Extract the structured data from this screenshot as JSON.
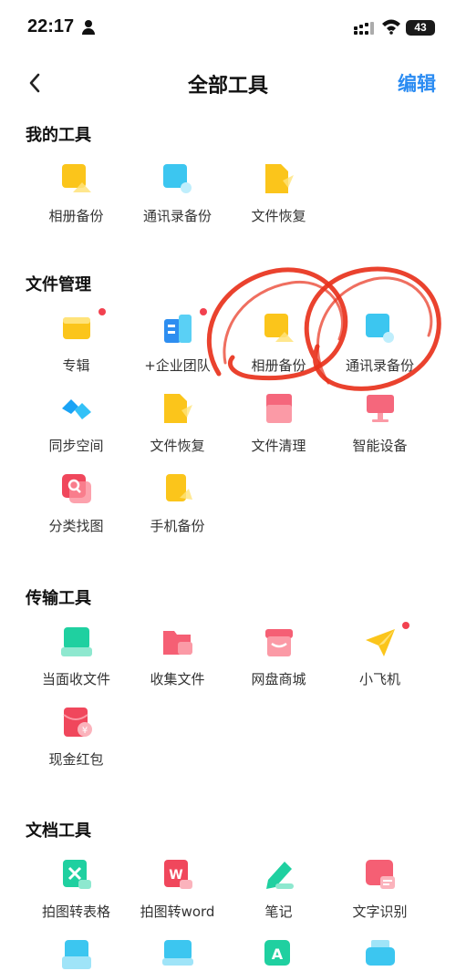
{
  "status_bar": {
    "time": "22:17",
    "battery": "43"
  },
  "header": {
    "title": "全部工具",
    "edit_label": "编辑"
  },
  "sections": [
    {
      "title": "我的工具",
      "tools": [
        {
          "label": "相册备份",
          "icon": "photo-backup-icon"
        },
        {
          "label": "通讯录备份",
          "icon": "contacts-backup-icon"
        },
        {
          "label": "文件恢复",
          "icon": "file-recovery-icon"
        },
        {
          "label": "",
          "icon": "empty-slot"
        }
      ]
    },
    {
      "title": "文件管理",
      "tools": [
        {
          "label": "专辑",
          "icon": "album-icon",
          "badge": true
        },
        {
          "label": "+企业团队",
          "icon": "enterprise-team-icon",
          "badge": true
        },
        {
          "label": "相册备份",
          "icon": "photo-backup-icon"
        },
        {
          "label": "通讯录备份",
          "icon": "contacts-backup-icon"
        },
        {
          "label": "同步空间",
          "icon": "sync-space-icon"
        },
        {
          "label": "文件恢复",
          "icon": "file-recovery-icon"
        },
        {
          "label": "文件清理",
          "icon": "file-cleanup-icon"
        },
        {
          "label": "智能设备",
          "icon": "smart-device-icon"
        },
        {
          "label": "分类找图",
          "icon": "category-search-icon"
        },
        {
          "label": "手机备份",
          "icon": "phone-backup-icon"
        }
      ]
    },
    {
      "title": "传输工具",
      "tools": [
        {
          "label": "当面收文件",
          "icon": "face-to-face-receive-icon"
        },
        {
          "label": "收集文件",
          "icon": "collect-files-icon"
        },
        {
          "label": "网盘商城",
          "icon": "store-icon"
        },
        {
          "label": "小飞机",
          "icon": "paper-plane-icon",
          "badge": true
        },
        {
          "label": "现金红包",
          "icon": "red-envelope-icon"
        }
      ]
    },
    {
      "title": "文档工具",
      "tools": [
        {
          "label": "拍图转表格",
          "icon": "photo-to-excel-icon"
        },
        {
          "label": "拍图转word",
          "icon": "photo-to-word-icon"
        },
        {
          "label": "笔记",
          "icon": "notes-icon"
        },
        {
          "label": "文字识别",
          "icon": "ocr-icon"
        },
        {
          "label": "",
          "icon": "scan-icon"
        },
        {
          "label": "",
          "icon": "screen-icon"
        },
        {
          "label": "",
          "icon": "translate-icon"
        },
        {
          "label": "",
          "icon": "printer-icon"
        }
      ]
    }
  ],
  "colors": {
    "accent": "#2a8bf2",
    "badge": "#f2414f",
    "annotation": "#e8321c"
  }
}
